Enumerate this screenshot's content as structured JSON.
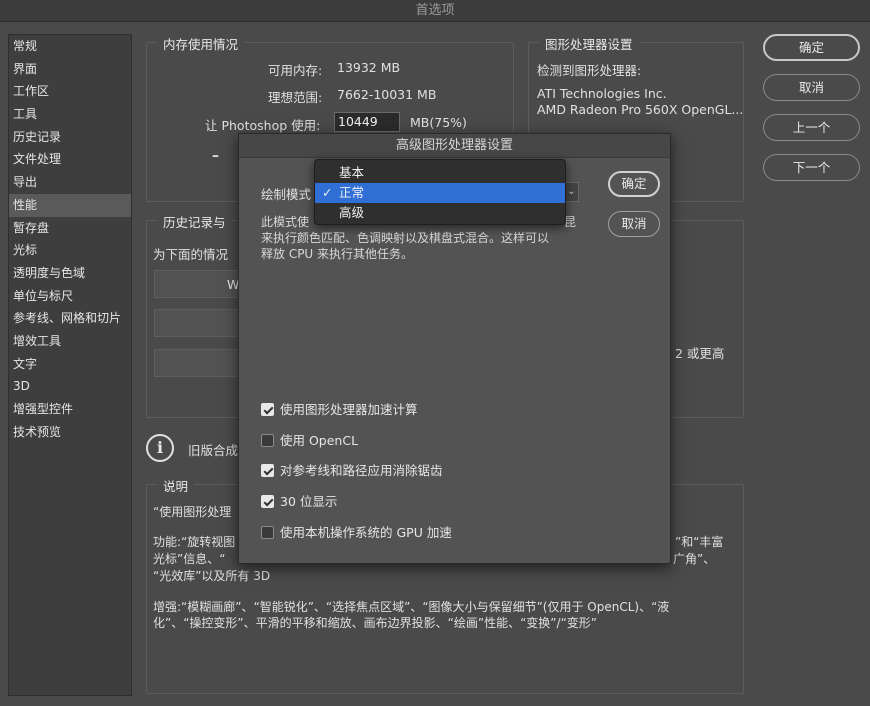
{
  "window": {
    "title": "首选项"
  },
  "sidebar": {
    "items": [
      {
        "label": "常规",
        "active": false
      },
      {
        "label": "界面",
        "active": false
      },
      {
        "label": "工作区",
        "active": false
      },
      {
        "label": "工具",
        "active": false
      },
      {
        "label": "历史记录",
        "active": false
      },
      {
        "label": "文件处理",
        "active": false
      },
      {
        "label": "导出",
        "active": false
      },
      {
        "label": "性能",
        "active": true
      },
      {
        "label": "暂存盘",
        "active": false
      },
      {
        "label": "光标",
        "active": false
      },
      {
        "label": "透明度与色域",
        "active": false
      },
      {
        "label": "单位与标尺",
        "active": false
      },
      {
        "label": "参考线、网格和切片",
        "active": false
      },
      {
        "label": "增效工具",
        "active": false
      },
      {
        "label": "文字",
        "active": false
      },
      {
        "label": "3D",
        "active": false
      },
      {
        "label": "增强型控件",
        "active": false
      },
      {
        "label": "技术预览",
        "active": false
      }
    ]
  },
  "memory": {
    "title": "内存使用情况",
    "available_label": "可用内存:",
    "available_value": "13932 MB",
    "ideal_label": "理想范围:",
    "ideal_value": "7662-10031 MB",
    "let_label": "让 Photoshop 使用:",
    "let_value": "10449",
    "let_unit": "MB(75%)",
    "slider_minus": "–"
  },
  "gpu": {
    "title": "图形处理器设置",
    "detected_label": "检测到图形处理器:",
    "vendor": "ATI Technologies Inc.",
    "model": "AMD Radeon Pro 560X OpenGL..."
  },
  "history": {
    "title": "历史记录与",
    "subtitle": "为下面的情况",
    "btn_fragment": "W"
  },
  "cache": {
    "text_fragment": "2 或更高"
  },
  "info": {
    "legacy_text": "旧版合成"
  },
  "explanation": {
    "title": "说明",
    "line1": "“使用图形处理",
    "line2_start": "功能:“旋转视图",
    "line2_end": "”和“丰富",
    "line3_start": "光标”信息、“",
    "line3_end": "广角”、",
    "line4": "“光效库”以及所有 3D",
    "line5": "增强:“模糊画廊”、“智能锐化”、“选择焦点区域”、“图像大小与保留细节”(仅用于 OpenCL)、“液",
    "line6": "化”、“操控变形”、平滑的平移和缩放、画布边界投影、“绘画”性能、“变换”/“变形”"
  },
  "right_buttons": {
    "ok": "确定",
    "cancel": "取消",
    "prev": "上一个",
    "next": "下一个"
  },
  "dialog": {
    "title": "高级图形处理器设置",
    "mode_label": "绘制模式",
    "desc_line1": "此模式使",
    "desc_line1_end": "昆",
    "desc_line2": "来执行颜色匹配、色调映射以及棋盘式混合。这样可以",
    "desc_line3": "释放 CPU 来执行其他任务。",
    "ok": "确定",
    "cancel": "取消",
    "options": [
      {
        "label": "使用图形处理器加速计算",
        "checked": true
      },
      {
        "label": "使用 OpenCL",
        "checked": false
      },
      {
        "label": "对参考线和路径应用消除锯齿",
        "checked": true
      },
      {
        "label": "30 位显示",
        "checked": true
      },
      {
        "label": "使用本机操作系统的 GPU 加速",
        "checked": false
      }
    ]
  },
  "mode_menu": {
    "items": [
      {
        "label": "基本",
        "selected": false
      },
      {
        "label": "正常",
        "selected": true
      },
      {
        "label": "高级",
        "selected": false
      }
    ],
    "check_glyph": "✓"
  },
  "colors": {
    "selection": "#2f6fd6",
    "background": "#4a4a4a"
  }
}
